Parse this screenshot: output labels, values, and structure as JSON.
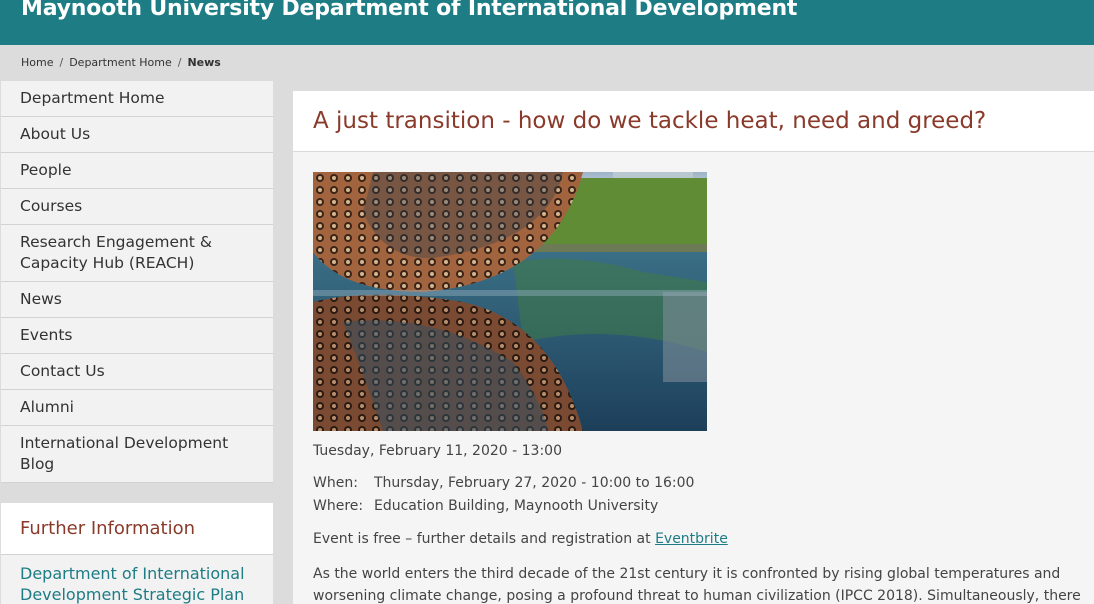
{
  "header": {
    "site_title": "Maynooth University Department of International Development"
  },
  "breadcrumb": {
    "items": [
      "Home",
      "Department Home"
    ],
    "separator": "/",
    "current": "News"
  },
  "sidebar": {
    "items": [
      {
        "label": "Department Home"
      },
      {
        "label": "About Us"
      },
      {
        "label": "People"
      },
      {
        "label": "Courses"
      },
      {
        "label": "Research Engagement & Capacity Hub (REACH)"
      },
      {
        "label": "News"
      },
      {
        "label": "Events"
      },
      {
        "label": "Contact Us"
      },
      {
        "label": "Alumni"
      },
      {
        "label": "International Development Blog"
      }
    ],
    "further": {
      "heading": "Further Information",
      "link": "Department of International Development Strategic Plan"
    }
  },
  "article": {
    "title": "A just transition - how do we tackle heat, need and greed?",
    "posted": "Tuesday, February 11, 2020 - 13:00",
    "when_label": "When:",
    "when_value": "Thursday, February 27, 2020 - 10:00 to 16:00",
    "where_label": "Where:",
    "where_value": "Education Building, Maynooth University",
    "free_text": "Event is free – further details and registration at",
    "free_link": "Eventbrite",
    "body": "As the world enters the third decade of the 21st century it is confronted by rising global temperatures and worsening climate change, posing a profound threat to human civilization (IPCC 2018). Simultaneously, there is deepening social"
  },
  "colors": {
    "brand_teal": "#1d7c84",
    "heading_maroon": "#8a3a2a"
  }
}
